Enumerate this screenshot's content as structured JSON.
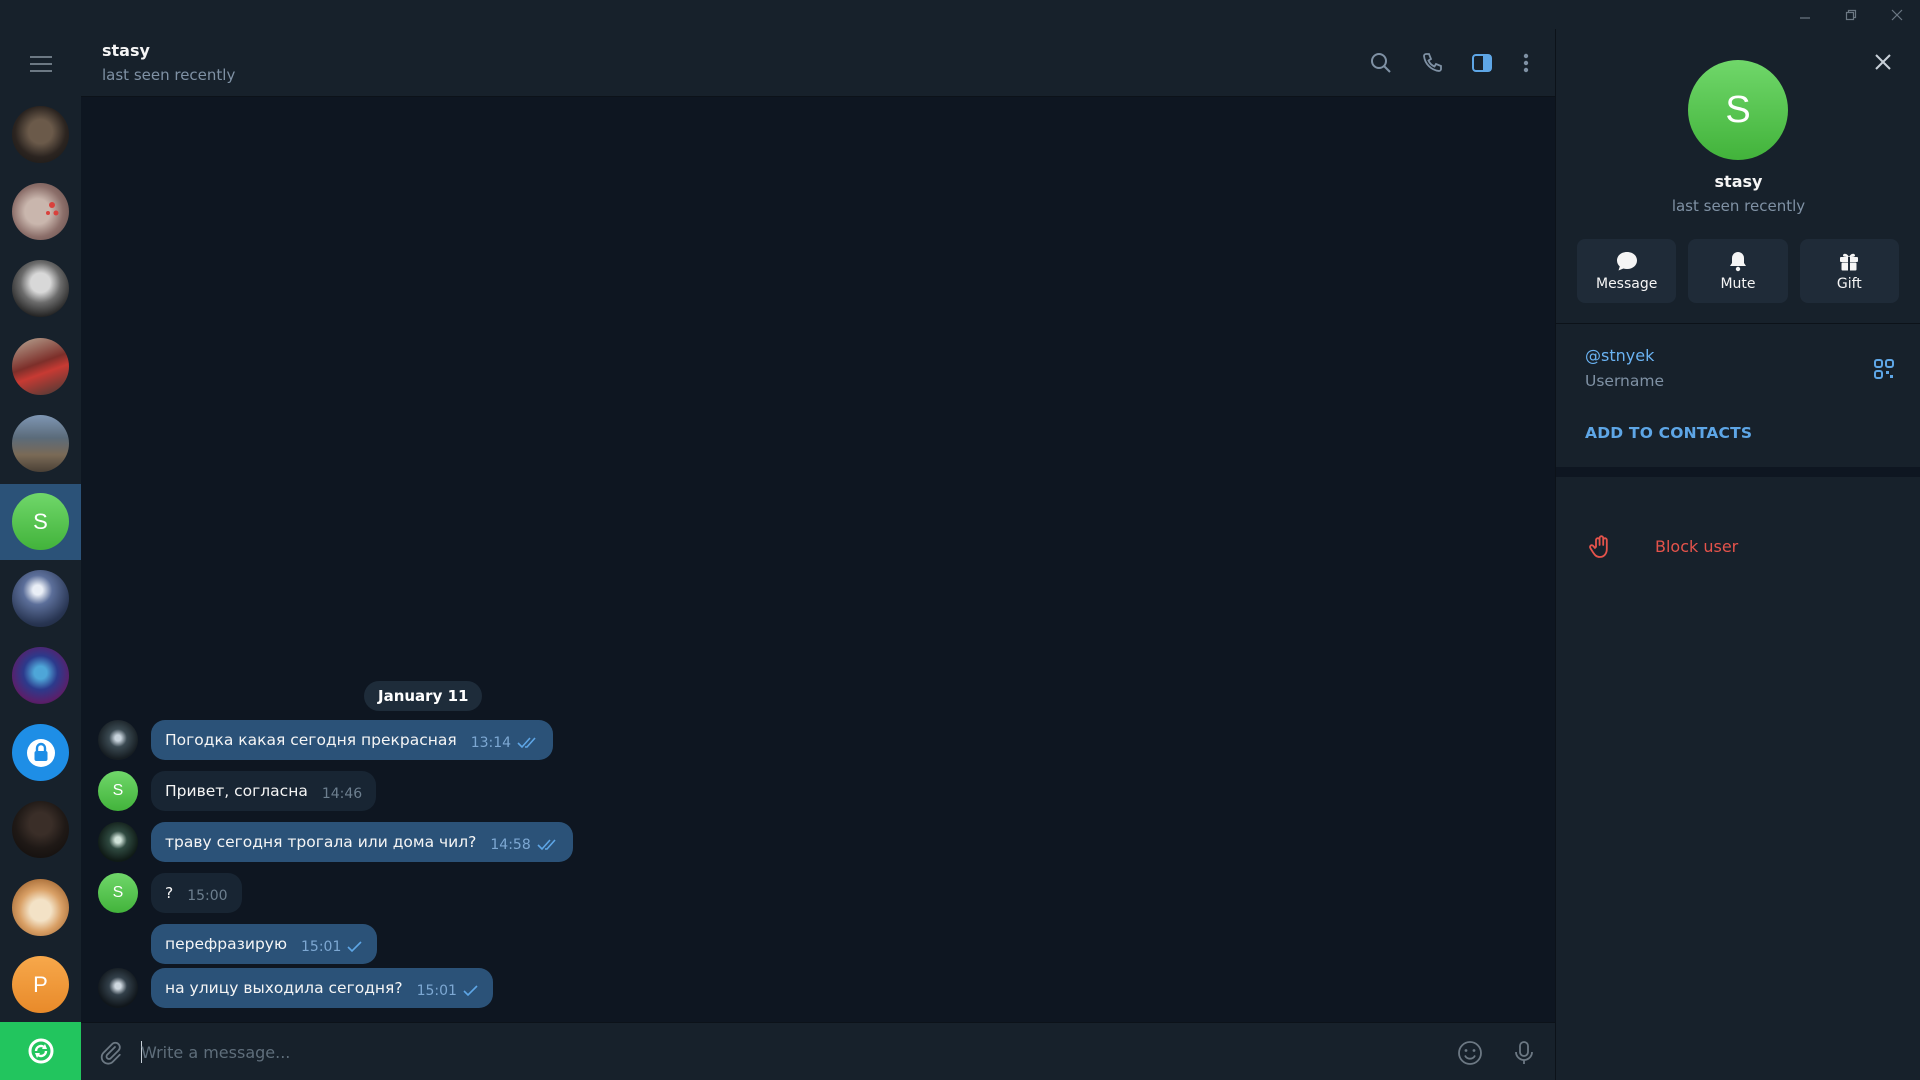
{
  "chat": {
    "title": "stasy",
    "status": "last seen recently",
    "date_separator": "January 11",
    "messages": [
      {
        "text": "Погодка какая сегодня прекрасная",
        "time": "13:14",
        "out": true,
        "read": true
      },
      {
        "text": "Привет, согласна",
        "time": "14:46",
        "out": false
      },
      {
        "text": "траву сегодня трогала или дома чил?",
        "time": "14:58",
        "out": true,
        "read": true
      },
      {
        "text": "?",
        "time": "15:00",
        "out": false
      },
      {
        "text": "перефразирую",
        "time": "15:01",
        "out": true,
        "read": false
      },
      {
        "text": "на улицу выходила сегодня?",
        "time": "15:01",
        "out": true,
        "read": false
      }
    ],
    "composer_placeholder": "Write a message..."
  },
  "sidebar": {
    "selected_avatar_letter": "S",
    "orange_avatar_letter": "P"
  },
  "panel": {
    "avatar_letter": "S",
    "name": "stasy",
    "status": "last seen recently",
    "actions": {
      "message": "Message",
      "mute": "Mute",
      "gift": "Gift"
    },
    "username": "@stnyek",
    "username_label": "Username",
    "add_to_contacts": "ADD TO CONTACTS",
    "block_user": "Block user"
  },
  "colors": {
    "bg": "#0e1621",
    "panel": "#17212b",
    "outgoing_bubble": "#2b5278",
    "incoming_bubble": "#182533",
    "accent": "#6ab3f3",
    "danger": "#e5534b",
    "green_avatar": "#4fbf45",
    "orange_avatar": "#f2993a"
  }
}
